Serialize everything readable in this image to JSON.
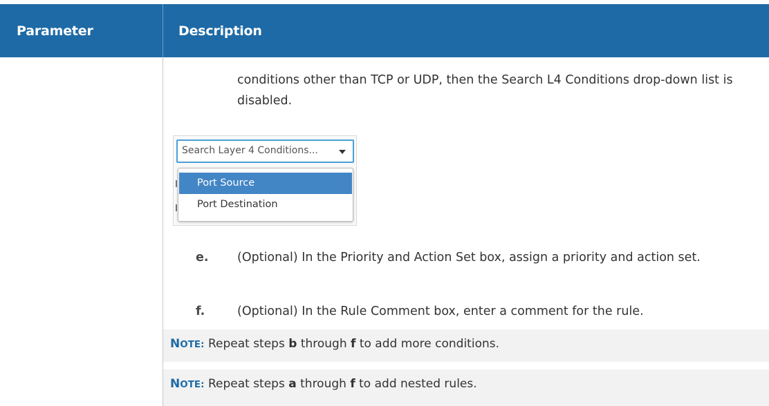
{
  "header": {
    "col_parameter": "Parameter",
    "col_description": "Description"
  },
  "intro": {
    "text": "conditions other than TCP or UDP, then the Search L4 Conditions drop-down list is disabled."
  },
  "figure": {
    "dropdown_placeholder": "Search Layer 4 Conditions...",
    "options": [
      "Port Source",
      "Port Destination"
    ],
    "highlighted_option": "Port Source"
  },
  "steps": [
    {
      "letter": "e.",
      "text": "(Optional) In the Priority and Action Set box, assign a priority and action set."
    },
    {
      "letter": "f.",
      "text": "(Optional) In the Rule Comment box, enter a comment for the rule."
    }
  ],
  "notes": [
    {
      "label_first": "N",
      "label_rest": "OTE:",
      "pre": "Repeat steps",
      "from": "b",
      "mid": "through",
      "to": "f",
      "post": "to add more conditions."
    },
    {
      "label_first": "N",
      "label_rest": "OTE:",
      "pre": "Repeat steps",
      "from": "a",
      "mid": "through",
      "to": "f",
      "post": "to add nested rules."
    }
  ],
  "colors": {
    "header_bg": "#1e6aa6",
    "note_bg": "#f2f2f2",
    "note_label": "#1e6aa6",
    "dropdown_border": "#4a9fd8",
    "highlight_bg": "#4386c6"
  }
}
